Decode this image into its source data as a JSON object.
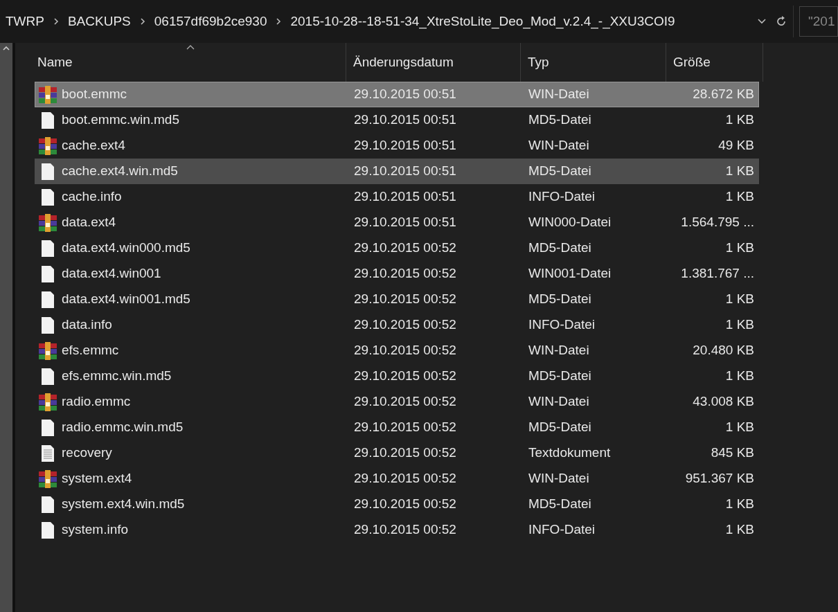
{
  "breadcrumb": [
    "TWRP",
    "BACKUPS",
    "06157df69b2ce930",
    "2015-10-28--18-51-34_XtreStoLite_Deo_Mod_v.2.4_-_XXU3COI9"
  ],
  "search": {
    "value": "\"201"
  },
  "columns": [
    {
      "label": "Name",
      "sorted": true
    },
    {
      "label": "Änderungsdatum",
      "sorted": false
    },
    {
      "label": "Typ",
      "sorted": false
    },
    {
      "label": "Größe",
      "sorted": false
    }
  ],
  "rows": [
    {
      "kind": "archive",
      "name": "boot.emmc",
      "date": "29.10.2015 00:51",
      "type": "WIN-Datei",
      "size": "28.672 KB",
      "selected": true,
      "hovered": false
    },
    {
      "kind": "file",
      "name": "boot.emmc.win.md5",
      "date": "29.10.2015 00:51",
      "type": "MD5-Datei",
      "size": "1 KB",
      "selected": false,
      "hovered": false
    },
    {
      "kind": "archive",
      "name": "cache.ext4",
      "date": "29.10.2015 00:51",
      "type": "WIN-Datei",
      "size": "49 KB",
      "selected": false,
      "hovered": false
    },
    {
      "kind": "file",
      "name": "cache.ext4.win.md5",
      "date": "29.10.2015 00:51",
      "type": "MD5-Datei",
      "size": "1 KB",
      "selected": false,
      "hovered": true
    },
    {
      "kind": "file",
      "name": "cache.info",
      "date": "29.10.2015 00:51",
      "type": "INFO-Datei",
      "size": "1 KB",
      "selected": false,
      "hovered": false
    },
    {
      "kind": "archive",
      "name": "data.ext4",
      "date": "29.10.2015 00:51",
      "type": "WIN000-Datei",
      "size": "1.564.795 ...",
      "selected": false,
      "hovered": false
    },
    {
      "kind": "file",
      "name": "data.ext4.win000.md5",
      "date": "29.10.2015 00:52",
      "type": "MD5-Datei",
      "size": "1 KB",
      "selected": false,
      "hovered": false
    },
    {
      "kind": "file",
      "name": "data.ext4.win001",
      "date": "29.10.2015 00:52",
      "type": "WIN001-Datei",
      "size": "1.381.767 ...",
      "selected": false,
      "hovered": false
    },
    {
      "kind": "file",
      "name": "data.ext4.win001.md5",
      "date": "29.10.2015 00:52",
      "type": "MD5-Datei",
      "size": "1 KB",
      "selected": false,
      "hovered": false
    },
    {
      "kind": "file",
      "name": "data.info",
      "date": "29.10.2015 00:52",
      "type": "INFO-Datei",
      "size": "1 KB",
      "selected": false,
      "hovered": false
    },
    {
      "kind": "archive",
      "name": "efs.emmc",
      "date": "29.10.2015 00:52",
      "type": "WIN-Datei",
      "size": "20.480 KB",
      "selected": false,
      "hovered": false
    },
    {
      "kind": "file",
      "name": "efs.emmc.win.md5",
      "date": "29.10.2015 00:52",
      "type": "MD5-Datei",
      "size": "1 KB",
      "selected": false,
      "hovered": false
    },
    {
      "kind": "archive",
      "name": "radio.emmc",
      "date": "29.10.2015 00:52",
      "type": "WIN-Datei",
      "size": "43.008 KB",
      "selected": false,
      "hovered": false
    },
    {
      "kind": "file",
      "name": "radio.emmc.win.md5",
      "date": "29.10.2015 00:52",
      "type": "MD5-Datei",
      "size": "1 KB",
      "selected": false,
      "hovered": false
    },
    {
      "kind": "text",
      "name": "recovery",
      "date": "29.10.2015 00:52",
      "type": "Textdokument",
      "size": "845 KB",
      "selected": false,
      "hovered": false
    },
    {
      "kind": "archive",
      "name": "system.ext4",
      "date": "29.10.2015 00:52",
      "type": "WIN-Datei",
      "size": "951.367 KB",
      "selected": false,
      "hovered": false
    },
    {
      "kind": "file",
      "name": "system.ext4.win.md5",
      "date": "29.10.2015 00:52",
      "type": "MD5-Datei",
      "size": "1 KB",
      "selected": false,
      "hovered": false
    },
    {
      "kind": "file",
      "name": "system.info",
      "date": "29.10.2015 00:52",
      "type": "INFO-Datei",
      "size": "1 KB",
      "selected": false,
      "hovered": false
    }
  ]
}
